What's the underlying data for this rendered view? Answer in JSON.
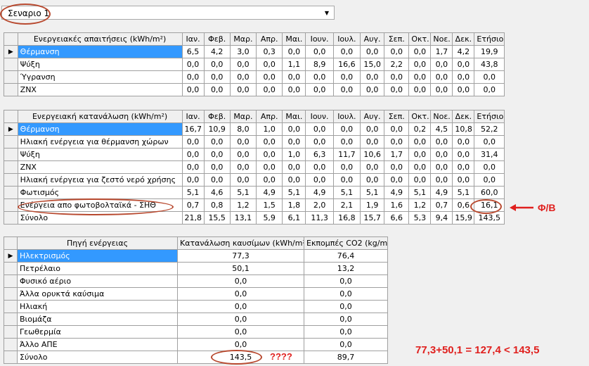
{
  "scenario": {
    "value": "Σεναριο 1"
  },
  "demands": {
    "header": [
      "Ενεργειακές απαιτήσεις (kWh/m²)",
      "Ιαν.",
      "Φεβ.",
      "Μαρ.",
      "Απρ.",
      "Μαι.",
      "Ιουν.",
      "Ιουλ.",
      "Αυγ.",
      "Σεπ.",
      "Οκτ.",
      "Νοε.",
      "Δεκ.",
      "Ετήσιο"
    ],
    "rows": [
      {
        "name": "Θέρμανση",
        "values": [
          "6,5",
          "4,2",
          "3,0",
          "0,3",
          "0,0",
          "0,0",
          "0,0",
          "0,0",
          "0,0",
          "0,0",
          "1,7",
          "4,2",
          "19,9"
        ]
      },
      {
        "name": "Ψύξη",
        "values": [
          "0,0",
          "0,0",
          "0,0",
          "0,0",
          "1,1",
          "8,9",
          "16,6",
          "15,0",
          "2,2",
          "0,0",
          "0,0",
          "0,0",
          "43,8"
        ]
      },
      {
        "name": "Ύγρανση",
        "values": [
          "0,0",
          "0,0",
          "0,0",
          "0,0",
          "0,0",
          "0,0",
          "0,0",
          "0,0",
          "0,0",
          "0,0",
          "0,0",
          "0,0",
          "0,0"
        ]
      },
      {
        "name": "ZNX",
        "values": [
          "0,0",
          "0,0",
          "0,0",
          "0,0",
          "0,0",
          "0,0",
          "0,0",
          "0,0",
          "0,0",
          "0,0",
          "0,0",
          "0,0",
          "0,0"
        ]
      }
    ]
  },
  "consumption": {
    "header": [
      "Ενεργειακή κατανάλωση (kWh/m²)",
      "Ιαν.",
      "Φεβ.",
      "Μαρ.",
      "Απρ.",
      "Μαι.",
      "Ιουν.",
      "Ιουλ.",
      "Αυγ.",
      "Σεπ.",
      "Οκτ.",
      "Νοε.",
      "Δεκ.",
      "Ετήσιο"
    ],
    "rows": [
      {
        "name": "Θέρμανση",
        "values": [
          "16,7",
          "10,9",
          "8,0",
          "1,0",
          "0,0",
          "0,0",
          "0,0",
          "0,0",
          "0,0",
          "0,2",
          "4,5",
          "10,8",
          "52,2"
        ]
      },
      {
        "name": "Ηλιακή ενέργεια για θέρμανση χώρων",
        "values": [
          "0,0",
          "0,0",
          "0,0",
          "0,0",
          "0,0",
          "0,0",
          "0,0",
          "0,0",
          "0,0",
          "0,0",
          "0,0",
          "0,0",
          "0,0"
        ]
      },
      {
        "name": "Ψύξη",
        "values": [
          "0,0",
          "0,0",
          "0,0",
          "0,0",
          "1,0",
          "6,3",
          "11,7",
          "10,6",
          "1,7",
          "0,0",
          "0,0",
          "0,0",
          "31,4"
        ]
      },
      {
        "name": "ZNX",
        "values": [
          "0,0",
          "0,0",
          "0,0",
          "0,0",
          "0,0",
          "0,0",
          "0,0",
          "0,0",
          "0,0",
          "0,0",
          "0,0",
          "0,0",
          "0,0"
        ]
      },
      {
        "name": "Ηλιακή ενέργεια για ζεστό νερό χρήσης",
        "values": [
          "0,0",
          "0,0",
          "0,0",
          "0,0",
          "0,0",
          "0,0",
          "0,0",
          "0,0",
          "0,0",
          "0,0",
          "0,0",
          "0,0",
          "0,0"
        ]
      },
      {
        "name": "Φωτισμός",
        "values": [
          "5,1",
          "4,6",
          "5,1",
          "4,9",
          "5,1",
          "4,9",
          "5,1",
          "5,1",
          "4,9",
          "5,1",
          "4,9",
          "5,1",
          "60,0"
        ]
      },
      {
        "name": "Ενέργεια απο φωτοβολταϊκά - ΣΗΘ",
        "values": [
          "0,7",
          "0,8",
          "1,2",
          "1,5",
          "1,8",
          "2,0",
          "2,1",
          "1,9",
          "1,6",
          "1,2",
          "0,7",
          "0,6",
          "16,1"
        ]
      },
      {
        "name": "Σύνολο",
        "values": [
          "21,8",
          "15,5",
          "13,1",
          "5,9",
          "6,1",
          "11,3",
          "16,8",
          "15,7",
          "6,6",
          "5,3",
          "9,4",
          "15,9",
          "143,5"
        ]
      }
    ]
  },
  "sources": {
    "header": [
      "Πηγή ενέργειας",
      "Κατανάλωση καυσίμων (kWh/m²)",
      "Εκπομπές CO2 (kg/m²)"
    ],
    "rows": [
      {
        "name": "Ηλεκτρισμός",
        "fuel": "77,3",
        "co2": "76,4"
      },
      {
        "name": "Πετρέλαιο",
        "fuel": "50,1",
        "co2": "13,2"
      },
      {
        "name": "Φυσικό αέριο",
        "fuel": "0,0",
        "co2": "0,0"
      },
      {
        "name": "Άλλα ορυκτά καύσιμα",
        "fuel": "0,0",
        "co2": "0,0"
      },
      {
        "name": "Ηλιακή",
        "fuel": "0,0",
        "co2": "0,0"
      },
      {
        "name": "Βιομάζα",
        "fuel": "0,0",
        "co2": "0,0"
      },
      {
        "name": "Γεωθερμία",
        "fuel": "0,0",
        "co2": "0,0"
      },
      {
        "name": "Άλλο ΑΠΕ",
        "fuel": "0,0",
        "co2": "0,0"
      },
      {
        "name": "Σύνολο",
        "fuel": "143,5",
        "co2": "89,7"
      }
    ]
  },
  "annotations": {
    "pv_label": "Φ/Β",
    "question": "????",
    "equation": "77,3+50,1 = 127,4 < 143,5",
    "color": "#e0201e",
    "oval_color": "#b8492f"
  },
  "colors": {
    "selected_row": "#3399ff",
    "grid_line": "#a0a0a0",
    "background": "#f0f0f0"
  }
}
